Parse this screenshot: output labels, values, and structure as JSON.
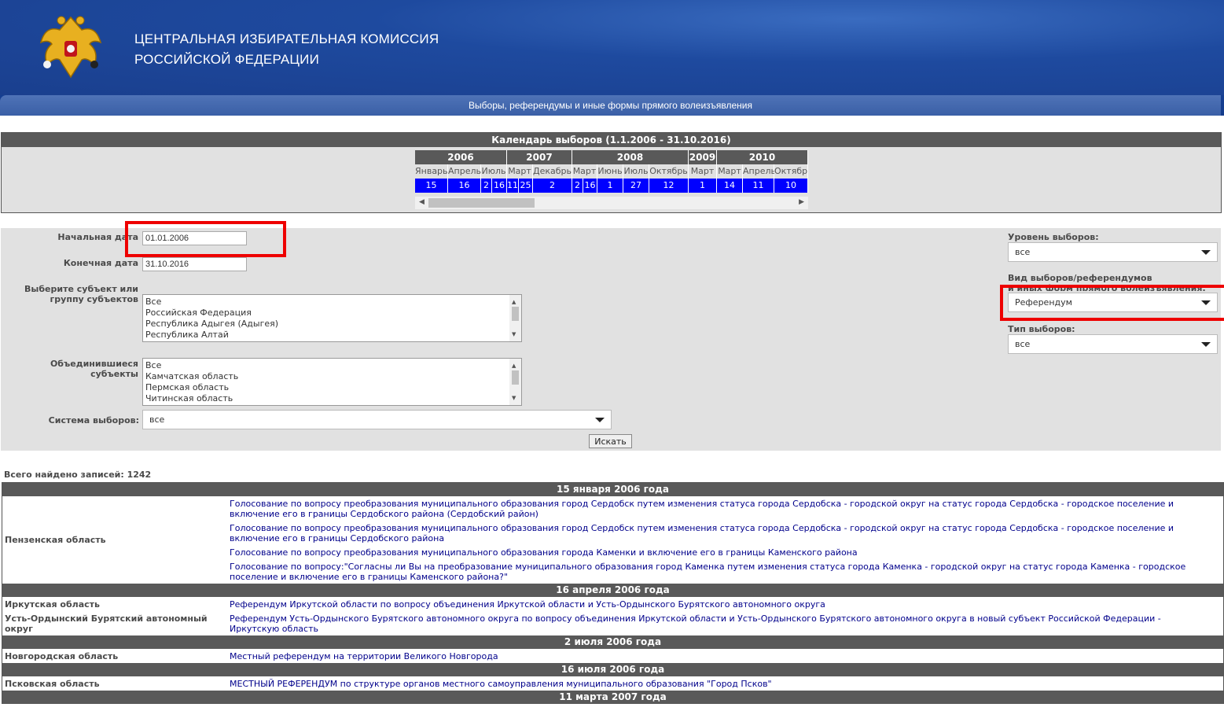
{
  "header": {
    "org_line1": "ЦЕНТРАЛЬНАЯ ИЗБИРАТЕЛЬНАЯ КОМИССИЯ",
    "org_line2": "РОССИЙСКОЙ ФЕДЕРАЦИИ",
    "subtitle": "Выборы, референдумы и иные формы прямого волеизъявления"
  },
  "calendar": {
    "title": "Календарь выборов (1.1.2006 - 31.10.2016)",
    "years": [
      "2006",
      "2007",
      "2008",
      "2009",
      "2010"
    ],
    "months": [
      "Январь",
      "Апрель",
      "Июль",
      "Март",
      "Декабрь",
      "Март",
      "Июнь",
      "Июль",
      "Октябрь",
      "Март",
      "Март",
      "Апрель",
      "Октябрь"
    ],
    "days": [
      "15",
      "16",
      "2",
      "16",
      "11",
      "25",
      "2",
      "2",
      "16",
      "1",
      "27",
      "12",
      "1",
      "14",
      "11",
      "10"
    ]
  },
  "form": {
    "start_label": "Начальная дата",
    "start_value": "01.01.2006",
    "end_label": "Конечная дата",
    "end_value": "31.10.2016",
    "subject_label": "Выберите субъект или группу субъектов",
    "subject_options": [
      "Все",
      "Российская Федерация",
      "Республика Адыгея (Адыгея)",
      "Республика Алтай"
    ],
    "merged_label": "Объединившиеся субъекты",
    "merged_options": [
      "Все",
      "Камчатская область",
      "Пермская область",
      "Читинская область"
    ],
    "system_label": "Система выборов:",
    "system_value": "все",
    "search_button": "Искать",
    "level_label": "Уровень выборов:",
    "level_value": "все",
    "kind_label_1": "Вид выборов/референдумов",
    "kind_label_2": "и иных форм прямого волеизъявления:",
    "kind_value": "Референдум",
    "type_label": "Тип выборов:",
    "type_value": "все"
  },
  "results": {
    "total": "Всего найдено записей: 1242",
    "dates": [
      "15 января 2006 года",
      "16 апреля 2006 года",
      "2 июля 2006 года",
      "16 июля 2006 года",
      "11 марта 2007 года"
    ],
    "penza": "Пензенская область",
    "penza_items": [
      "Голосование по вопросу преобразования муниципального образования город Сердобск путем изменения статуса города Сердобска - городской округ на статус города Сердобска - городское поселение и включение его в границы Сердобского района (Сердобский район)",
      "Голосование по вопросу преобразования муниципального образования город Сердобск путем изменения статуса города Сердобска - городской округ на статус города Сердобска - городское поселение и включение его в границы Сердобского района",
      "Голосование по вопросу преобразования муниципального образования города Каменки и включение его в границы Каменского района",
      "Голосование по вопросу:\"Согласны ли Вы на преобразование муниципального образования город Каменка путем изменения статуса города Каменка - городской округ на статус города Каменка - городское поселение и включение его в границы Каменского района?\""
    ],
    "irkutsk": "Иркутская область",
    "irkutsk_item": "Референдум Иркутской области по вопросу объединения Иркутской области и Усть-Ордынского Бурятского автономного округа",
    "ust": "Усть-Ордынский Бурятский автономный округ",
    "ust_item": "Референдум Усть-Ордынского Бурятского автономного округа по вопросу объединения Иркутской области и Усть-Ордынского Бурятского автономного округа в новый субъект Российской Федерации - Иркутскую область",
    "novgorod": "Новгородская область",
    "novgorod_item": "Местный референдум на территории Великого Новгорода",
    "pskov": "Псковская область",
    "pskov_item": "МЕСТНЫЙ РЕФЕРЕНДУМ по структуре органов местного самоуправления муниципального образования \"Город Псков\""
  }
}
